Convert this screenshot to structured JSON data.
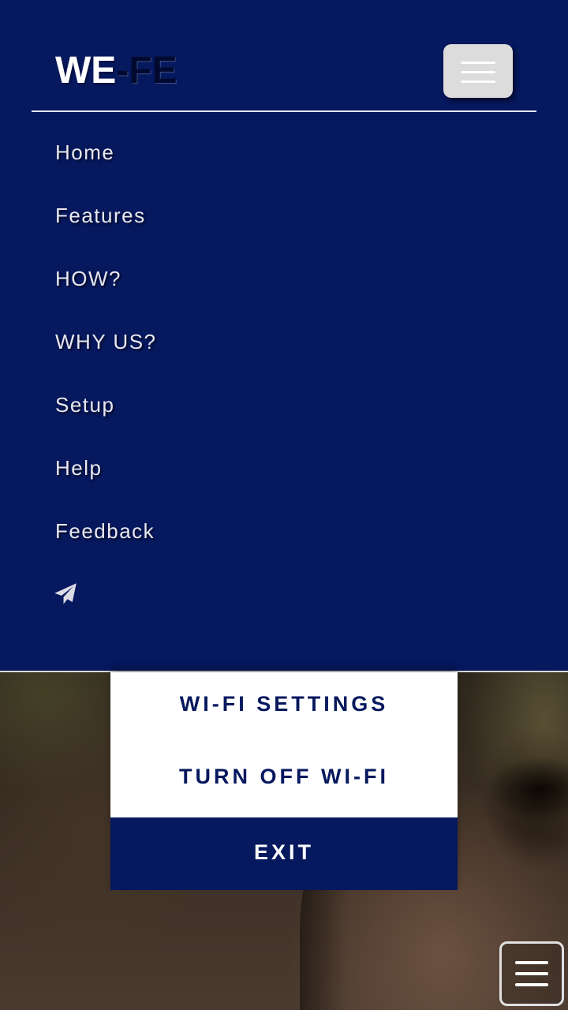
{
  "navbar": {
    "brand_part1": "WE",
    "brand_part2": "-FE",
    "items": [
      {
        "label": "Home"
      },
      {
        "label": "Features"
      },
      {
        "label": "HOW?"
      },
      {
        "label": "WHY US?"
      },
      {
        "label": "Setup"
      },
      {
        "label": "Help"
      },
      {
        "label": "Feedback"
      }
    ],
    "extra_icon": "paper-plane-icon",
    "toggler_icon": "hamburger-icon"
  },
  "popup_menu": {
    "items": [
      {
        "label": "WI-FI SETTINGS"
      },
      {
        "label": "TURN OFF WI-FI"
      },
      {
        "label": "EXIT"
      }
    ]
  },
  "floating_button": {
    "icon": "hamburger-icon"
  },
  "colors": {
    "primary": "#06185e",
    "text_light": "#e8e8f0",
    "toggler_bg": "#dcdcdc",
    "popup_bg": "#ffffff"
  }
}
